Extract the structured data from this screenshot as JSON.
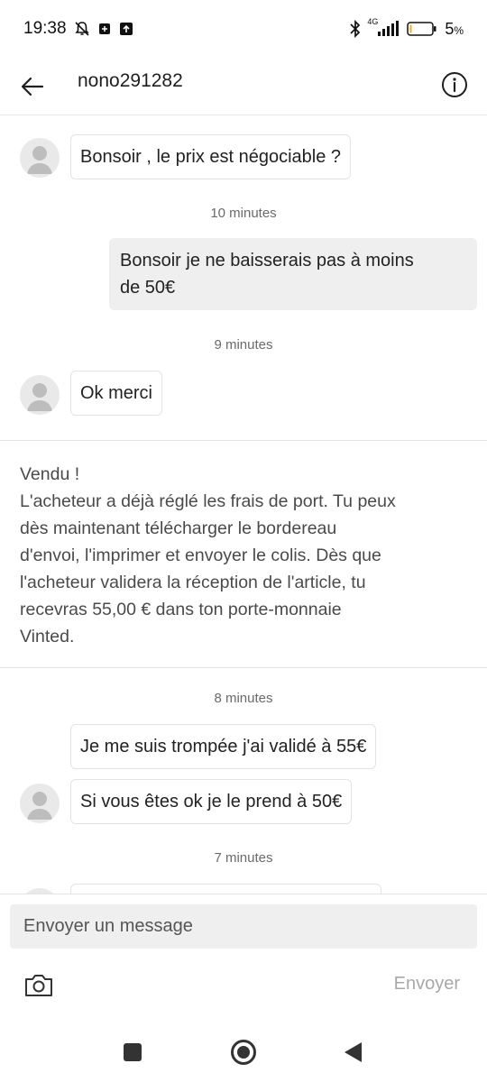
{
  "status_bar": {
    "time": "19:38",
    "network": "4G",
    "battery": "5",
    "battery_unit": "%"
  },
  "header": {
    "title": "nono291282"
  },
  "messages": [
    {
      "text": "Bonsoir , le prix est négociable ?"
    },
    {
      "timestamp": "10 minutes"
    },
    {
      "text_line1": "Bonsoir je ne baisserais pas à moins",
      "text_line2": "de 50€"
    },
    {
      "timestamp": "9 minutes"
    },
    {
      "text": "Ok merci"
    },
    {
      "timestamp": "8 minutes"
    },
    {
      "text": "Je me suis trompée j'ai validé à 55€"
    },
    {
      "text": "Si vous êtes ok je le prend à 50€"
    },
    {
      "timestamp": "7 minutes"
    }
  ],
  "system_message": {
    "title": "Vendu !",
    "lines": [
      "L'acheteur a déjà réglé les frais de port. Tu peux",
      "dès maintenant télécharger le bordereau",
      "d'envoi, l'imprimer et envoyer le colis. Dès que",
      "l'acheteur validera la réception de l'article, tu",
      "recevras 55,00 € dans ton porte-monnaie",
      "Vinted."
    ]
  },
  "composer": {
    "placeholder": "Envoyer un message",
    "send_label": "Envoyer"
  },
  "colors": {
    "incoming_bubble_bg": "#ffffff",
    "outgoing_bubble_bg": "#efefef",
    "send_disabled": "#a8a8a8"
  }
}
